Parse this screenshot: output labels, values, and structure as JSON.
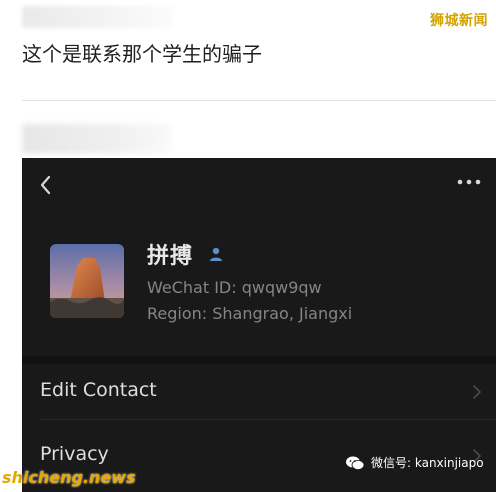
{
  "post": {
    "text": "这个是联系那个学生的骗子"
  },
  "watermarks": {
    "top": "狮城新闻",
    "bottom": "shicheng.news",
    "wechat": "微信号: kanxinjiapo"
  },
  "profile": {
    "name": "拼搏",
    "wechat_id": "WeChat ID: qwqw9qw",
    "region": "Region: Shangrao, Jiangxi"
  },
  "menu": {
    "items": [
      {
        "label": "Edit Contact"
      },
      {
        "label": "Privacy"
      }
    ]
  },
  "icons": {
    "back": "back-chevron-icon",
    "more": "more-dots-icon",
    "user": "user-badge-icon",
    "chevron": "chevron-right-icon"
  }
}
